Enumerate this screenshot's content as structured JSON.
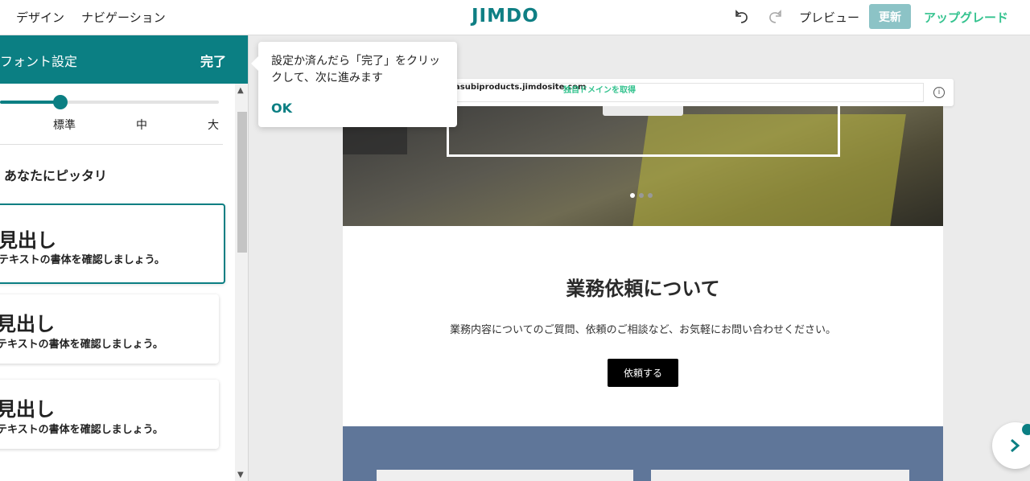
{
  "topbar": {
    "design_label": "デザイン",
    "navigation_label": "ナビゲーション",
    "logo_text": "JIMDO",
    "preview_label": "プレビュー",
    "update_label": "更新",
    "upgrade_label": "アップグレード"
  },
  "panel": {
    "title": "フォント設定",
    "done_label": "完了",
    "size_options": [
      "標準",
      "中",
      "大"
    ],
    "size_level": "標準",
    "section_title": "あなたにピッタリ",
    "cards": [
      {
        "heading": "見出し",
        "body": "テキストの書体を確認しましょう。",
        "selected": true
      },
      {
        "heading": "見出し",
        "body": "テキストの書体を確認しましょう。",
        "selected": false
      },
      {
        "heading": "見出し",
        "body": "テキストの書体を確認しましょう。",
        "selected": false
      }
    ]
  },
  "tooltip": {
    "text": "設定か済んだら「完了」をクリックして、次に進みます",
    "ok_label": "OK"
  },
  "browser": {
    "url": "asubiproducts.jimdosite.com",
    "domain_link": "独自ドメインを取得"
  },
  "site": {
    "carousel_total": 3,
    "carousel_active": 1,
    "about_title": "業務依頼について",
    "about_text": "業務内容についてのご質問、依頼のご相談など、お気軽にお問い合わせください。",
    "about_button": "依頼する"
  },
  "colors": {
    "brand": "#0b7f83",
    "upgrade": "#35c38f",
    "update_button": "#8cc3c6",
    "section_band": "#5f7699"
  },
  "icons": [
    "undo-icon",
    "redo-icon",
    "info-icon",
    "chevron-right-icon",
    "chevron-up-icon",
    "chevron-down-icon"
  ]
}
